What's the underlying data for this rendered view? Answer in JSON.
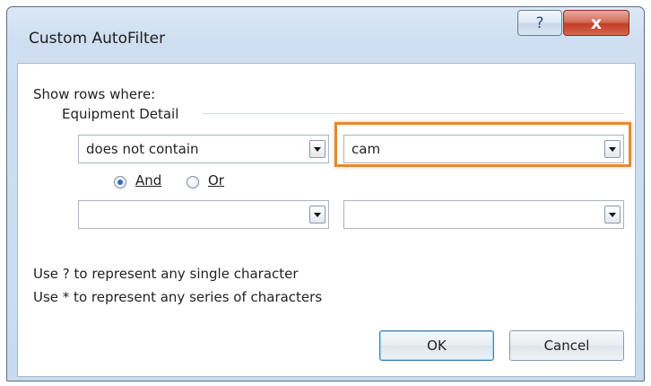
{
  "dialog": {
    "title": "Custom AutoFilter",
    "help_glyph": "?",
    "close_glyph": "x"
  },
  "filter": {
    "show_rows_label": "Show rows where:",
    "field_name": "Equipment Detail",
    "condition1": {
      "operator": "does not contain",
      "value": "cam"
    },
    "logic": {
      "and_label": "And",
      "or_label": "Or",
      "selected": "And"
    },
    "condition2": {
      "operator": "",
      "value": ""
    }
  },
  "hints": {
    "single_char": "Use ? to represent any single character",
    "series_chars": "Use * to represent any series of characters"
  },
  "buttons": {
    "ok": "OK",
    "cancel": "Cancel"
  },
  "colors": {
    "highlight": "#e28a34",
    "close_button": "#c23f26"
  }
}
